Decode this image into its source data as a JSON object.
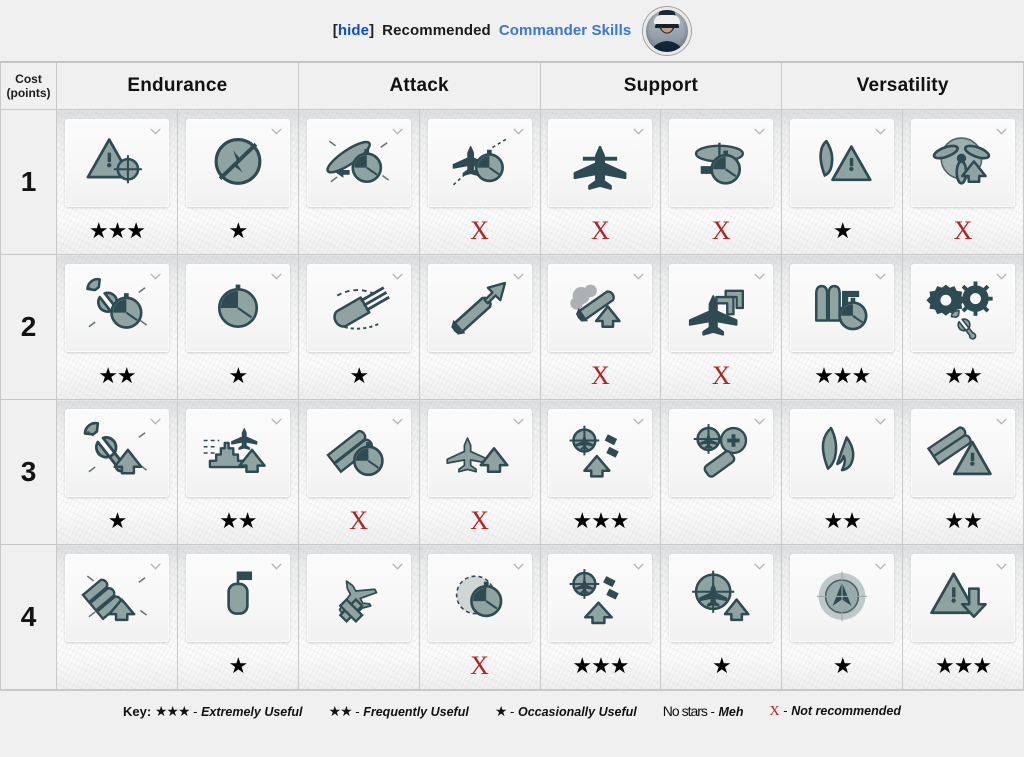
{
  "header": {
    "hide_label": "[hide]",
    "hide_bracket_open": "[",
    "hide_word": "hide",
    "hide_bracket_close": "]",
    "title_plain": "Recommended",
    "title_link": "Commander Skills",
    "avatar_name": "commander-portrait"
  },
  "table": {
    "cost_header_line1": "Cost",
    "cost_header_line2": "(points)",
    "categories": [
      {
        "label": "Endurance"
      },
      {
        "label": "Attack"
      },
      {
        "label": "Support"
      },
      {
        "label": "Versatility"
      }
    ],
    "rows": [
      {
        "cost": "1",
        "cells": [
          {
            "icon": "warning-triangle-target-icon",
            "rating": "★★★",
            "rating_type": "stars",
            "stars": 3
          },
          {
            "icon": "no-torpedo-detection-icon",
            "rating": "★",
            "rating_type": "stars",
            "stars": 1
          },
          {
            "icon": "ship-speed-stopwatch-icon",
            "rating": "",
            "rating_type": "none",
            "stars": 0
          },
          {
            "icon": "aircraft-stopwatch-icon",
            "rating": "X",
            "rating_type": "cross",
            "stars": 0
          },
          {
            "icon": "biplane-torpedo-icon",
            "rating": "X",
            "rating_type": "cross",
            "stars": 0
          },
          {
            "icon": "aa-gun-stopwatch-icon",
            "rating": "X",
            "rating_type": "cross",
            "stars": 0
          },
          {
            "icon": "torpedo-warning-icon",
            "rating": "★",
            "rating_type": "stars",
            "stars": 1
          },
          {
            "icon": "propeller-boost-icon",
            "rating": "X",
            "rating_type": "cross",
            "stars": 0
          }
        ]
      },
      {
        "cost": "2",
        "cells": [
          {
            "icon": "wrench-stopwatch-icon",
            "rating": "★★",
            "rating_type": "stars",
            "stars": 2
          },
          {
            "icon": "stopwatch-icon",
            "rating": "★",
            "rating_type": "stars",
            "stars": 1
          },
          {
            "icon": "gun-turret-traverse-icon",
            "rating": "★",
            "rating_type": "stars",
            "stars": 1
          },
          {
            "icon": "shell-arrow-up-icon",
            "rating": "",
            "rating_type": "none",
            "stars": 0
          },
          {
            "icon": "smoke-boost-icon",
            "rating": "X",
            "rating_type": "cross",
            "stars": 0
          },
          {
            "icon": "bomber-arrows-icon",
            "rating": "X",
            "rating_type": "cross",
            "stars": 0
          },
          {
            "icon": "torpedo-tubes-stopwatch-icon",
            "rating": "★★★",
            "rating_type": "stars",
            "stars": 3
          },
          {
            "icon": "gears-wrench-icon",
            "rating": "★★",
            "rating_type": "stars",
            "stars": 2
          }
        ]
      },
      {
        "cost": "3",
        "cells": [
          {
            "icon": "wrench-arrow-up-icon",
            "rating": "★",
            "rating_type": "stars",
            "stars": 1
          },
          {
            "icon": "carrier-plane-arrow-up-icon",
            "rating": "★★",
            "rating_type": "stars",
            "stars": 2
          },
          {
            "icon": "torpedo-tubes-timer-icon",
            "rating": "X",
            "rating_type": "cross",
            "stars": 0
          },
          {
            "icon": "plane-arrow-up-icon",
            "rating": "X",
            "rating_type": "cross",
            "stars": 0
          },
          {
            "icon": "plane-target-flak-arrow-icon",
            "rating": "★★★",
            "rating_type": "stars",
            "stars": 3
          },
          {
            "icon": "plane-target-plus-icon",
            "rating": "",
            "rating_type": "none",
            "stars": 0
          },
          {
            "icon": "fire-torpedo-icon",
            "rating": "★★",
            "rating_type": "stars",
            "stars": 2
          },
          {
            "icon": "torpedo-warning-triangle-icon",
            "rating": "★★",
            "rating_type": "stars",
            "stars": 2
          }
        ]
      },
      {
        "cost": "4",
        "cells": [
          {
            "icon": "shells-arrow-up-icon",
            "rating": "",
            "rating_type": "none",
            "stars": 0
          },
          {
            "icon": "flag-depth-charge-icon",
            "rating": "★",
            "rating_type": "stars",
            "stars": 1
          },
          {
            "icon": "plane-strike-arrow-icon",
            "rating": "",
            "rating_type": "none",
            "stars": 0
          },
          {
            "icon": "radar-stopwatch-icon",
            "rating": "X",
            "rating_type": "cross",
            "stars": 0
          },
          {
            "icon": "plane-target-flak-arrow-up-icon",
            "rating": "★★★",
            "rating_type": "stars",
            "stars": 3
          },
          {
            "icon": "plane-crosshair-arrow-icon",
            "rating": "★",
            "rating_type": "stars",
            "stars": 1
          },
          {
            "icon": "radar-sonar-icon",
            "rating": "★",
            "rating_type": "stars",
            "stars": 1
          },
          {
            "icon": "warning-arrow-down-icon",
            "rating": "★★★",
            "rating_type": "stars",
            "stars": 3
          }
        ]
      }
    ]
  },
  "legend": {
    "key_label": "Key:",
    "items": [
      {
        "sym": "★★★",
        "sym_type": "stars",
        "sep": "-",
        "desc": "Extremely Useful"
      },
      {
        "sym": "★★",
        "sym_type": "stars",
        "sep": "-",
        "desc": "Frequently Useful"
      },
      {
        "sym": "★",
        "sym_type": "stars",
        "sep": "-",
        "desc": "Occasionally Useful"
      },
      {
        "sym": "No stars",
        "sym_type": "text",
        "sep": "-",
        "desc": "Meh"
      },
      {
        "sym": "X",
        "sym_type": "cross",
        "sep": "-",
        "desc": "Not recommended"
      }
    ]
  },
  "colors": {
    "link": "#3b77d4",
    "hide_link": "#0b4ec7",
    "cross_red": "#b22222",
    "icon_dark": "#2e4a52",
    "icon_mid": "#8fa3a3",
    "panel_bg": "#f0f0f0",
    "border": "#c8c8c8"
  }
}
